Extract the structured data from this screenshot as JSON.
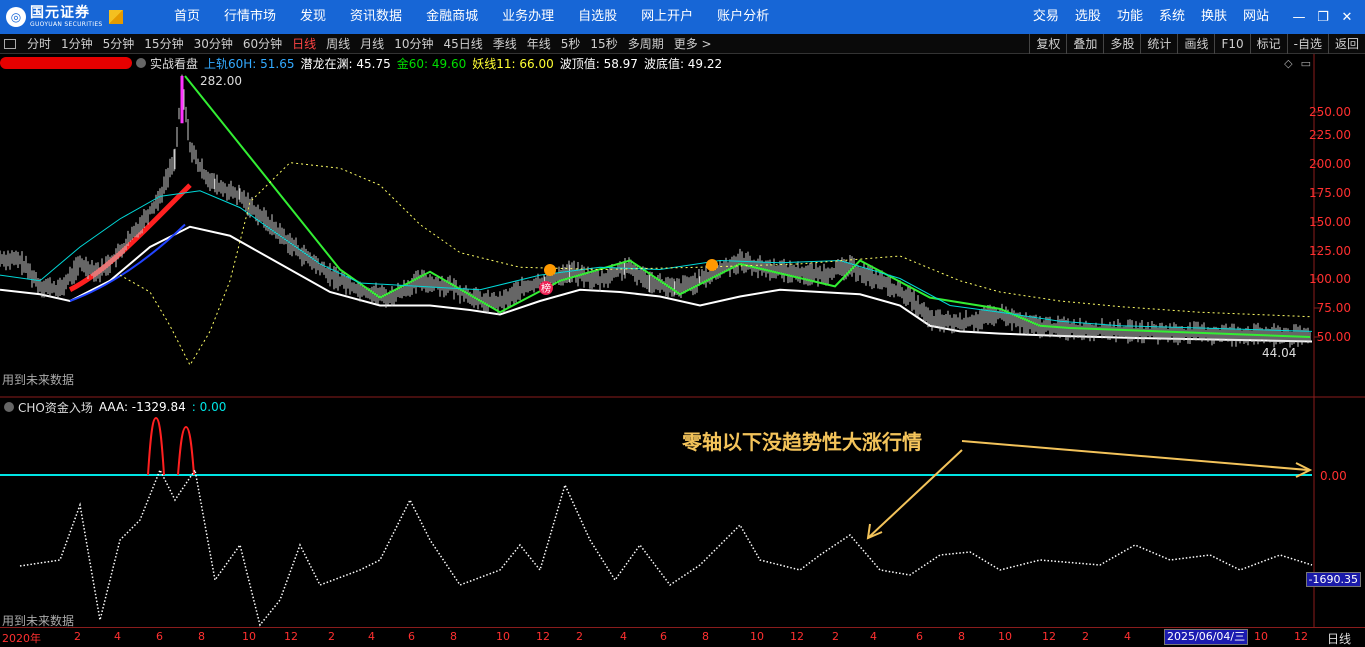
{
  "nav": {
    "logo_cn": "国元证券",
    "logo_en": "GUOYUAN SECURITIES",
    "main_items": [
      "首页",
      "行情市场",
      "发现",
      "资讯数据",
      "金融商城",
      "业务办理",
      "自选股",
      "网上开户",
      "账户分析"
    ],
    "right_items": [
      "交易",
      "选股",
      "功能",
      "系统",
      "换肤",
      "网站"
    ],
    "window_controls": [
      "minimize-icon",
      "restore-icon",
      "close-icon"
    ]
  },
  "periods": {
    "items": [
      "分时",
      "1分钟",
      "5分钟",
      "15分钟",
      "30分钟",
      "60分钟",
      "日线",
      "周线",
      "月线",
      "10分钟",
      "45日线",
      "季线",
      "年线",
      "5秒",
      "15秒",
      "多周期",
      "更多 >"
    ],
    "active": "日线"
  },
  "tools": [
    "复权",
    "叠加",
    "多股",
    "统计",
    "画线",
    "F10",
    "标记",
    "-自选",
    "返回"
  ],
  "main_indicator": {
    "name": "实战看盘",
    "fields": [
      {
        "label": "上轨60H: 51.65",
        "color": "#33aaff"
      },
      {
        "label": "潜龙在渊: 45.75",
        "color": "#ffffff"
      },
      {
        "label": "金60: 49.60",
        "color": "#00dd00"
      },
      {
        "label": "妖线11: 66.00",
        "color": "#ffff33"
      },
      {
        "label": "波顶值: 58.97",
        "color": "#ffffff"
      },
      {
        "label": "波底值: 49.22",
        "color": "#ffffff"
      }
    ],
    "high_label": "282.00",
    "low_label": "44.04",
    "future_data_note": "用到未来数据",
    "badge_text": "榜"
  },
  "sub_indicator": {
    "name": "CHO资金入场",
    "fields": [
      {
        "label": "AAA: -1329.84",
        "color": "#ffffff"
      },
      {
        "label": ": 0.00",
        "color": "#00e5e5"
      }
    ],
    "future_data_note": "用到未来数据",
    "cursor_value": "-1690.35"
  },
  "price_axis": [
    "250.00",
    "225.00",
    "200.00",
    "175.00",
    "150.00",
    "125.00",
    "100.00",
    "75.00",
    "50.00"
  ],
  "sub_axis": [
    "0.00"
  ],
  "date_axis": [
    "2020年",
    "2",
    "4",
    "6",
    "8",
    "10",
    "12",
    "2",
    "4",
    "6",
    "8",
    "10",
    "12",
    "2",
    "4",
    "6",
    "8",
    "10",
    "12",
    "2",
    "4",
    "6",
    "8",
    "10",
    "12",
    "2",
    "4",
    "6",
    "8",
    "10",
    "12",
    "2",
    "4",
    "10",
    "12"
  ],
  "date_cursor": "2025/06/04/三",
  "period_label": "日线",
  "annotation": "零轴以下没趋势性大涨行情",
  "colors": {
    "nav_bg": "#1766d6",
    "axis_red": "#ff3030",
    "price_line": "#ffffff",
    "trend_green": "#33ee33",
    "cyan": "#00e5e5",
    "yellow_dots": "#ffff66",
    "annotation": "#f3c35a"
  }
}
